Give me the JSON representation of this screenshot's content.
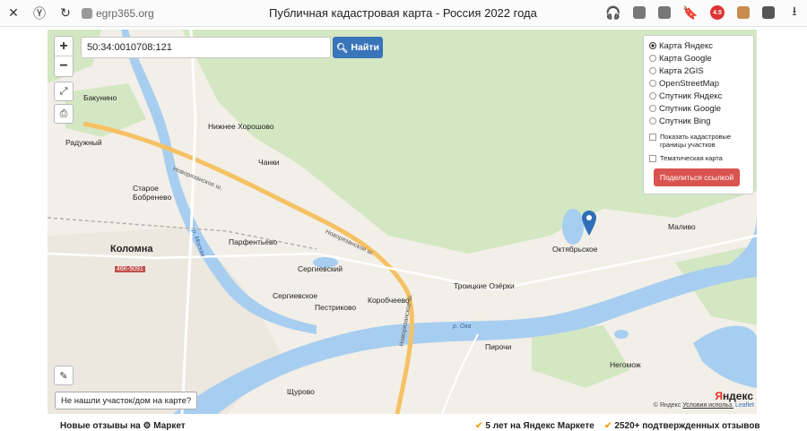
{
  "browser": {
    "url": "egrp365.org",
    "title": "Публичная кадастровая карта - Россия 2022 года",
    "badge": "4.5"
  },
  "search": {
    "value": "50:34:0010708:121",
    "button_label": "Найти"
  },
  "layers": {
    "items": [
      {
        "label": "Карта Яндекс",
        "selected": true
      },
      {
        "label": "Карта Google",
        "selected": false
      },
      {
        "label": "Карта 2GIS",
        "selected": false
      },
      {
        "label": "OpenStreetMap",
        "selected": false
      },
      {
        "label": "Спутник Яндекс",
        "selected": false
      },
      {
        "label": "Спутник Google",
        "selected": false
      },
      {
        "label": "Спутник Bing",
        "selected": false
      }
    ],
    "show_borders_label": "Показать кадастровые границы участков",
    "thematic_label": "Тематическая карта",
    "share_label": "Поделиться ссылкой"
  },
  "map": {
    "places": {
      "bakunino": "Бакунино",
      "nizhnee_khoroshovo": "Нижнее Хорошово",
      "raduzhny": "Радужный",
      "chanki": "Чанки",
      "staroe_bobrenevo": "Старое Бобренево",
      "kolomna": "Коломна",
      "parfentevo": "Парфентьево",
      "sergievsky": "Сергиевский",
      "sergievskoe": "Сергиевское",
      "korobcheevo": "Коробчеево",
      "pestrikovo": "Пестриково",
      "troitskie_ozerki": "Троицкие Озёрки",
      "oktyabrskoe": "Октябрьское",
      "malivo": "Маливо",
      "pirochi": "Пирочи",
      "negomozh": "Негомож",
      "shchurovo": "Щурово"
    },
    "roads": {
      "novoryazanskoe1": "Новорязанское ш.",
      "novoryazanskoe2": "Новорязанское ш.",
      "novoryazanskoe3": "Новорязанское ш.",
      "road_code": "46К-5091"
    },
    "rivers": {
      "oka": "р. Ока",
      "moskva": "р. Москва"
    },
    "help_button": "Не нашли участок/дом на карте?",
    "attribution_prefix": "© Яндекс",
    "attribution_link": "Условия использ.",
    "leaflet": "Leaflet",
    "yandex_logo_y": "Я",
    "yandex_logo_rest": "ндекс"
  },
  "footer": {
    "left": "Новые отзывы на ⚙ Маркет",
    "item1": "5 лет на Яндекс Маркете",
    "item2": "2520+ подтвержденных отзывов"
  },
  "colors": {
    "water": "#a7cef0",
    "forest": "#d4e7c3",
    "highway": "#f6c164",
    "search_button": "#3a74b9",
    "share_button": "#d9534f",
    "marker": "#2e6fb8"
  }
}
